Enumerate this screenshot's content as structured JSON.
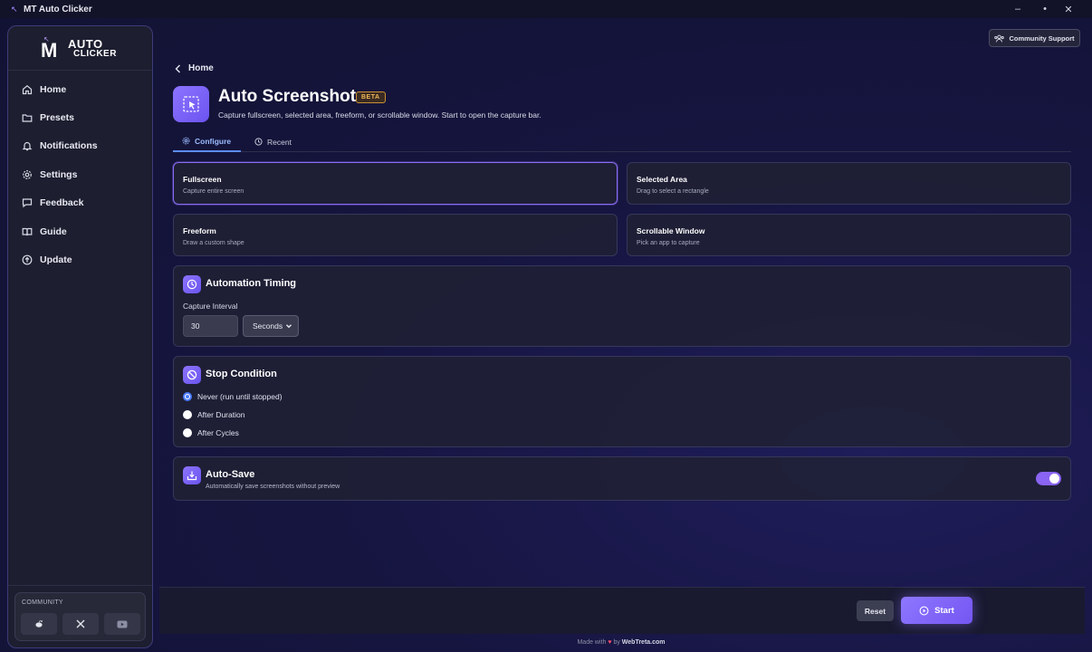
{
  "window": {
    "title": "MT Auto Clicker",
    "minimize": "–",
    "maximize": "•",
    "close": "✕"
  },
  "logo": {
    "mark": "M",
    "line1": "AUTO",
    "line2": "CLICKER"
  },
  "sidebar": {
    "items": [
      {
        "label": "Home",
        "icon": "home-icon"
      },
      {
        "label": "Presets",
        "icon": "folder-icon"
      },
      {
        "label": "Notifications",
        "icon": "bell-icon"
      },
      {
        "label": "Settings",
        "icon": "gear-icon"
      },
      {
        "label": "Feedback",
        "icon": "message-icon"
      },
      {
        "label": "Guide",
        "icon": "book-icon"
      },
      {
        "label": "Update",
        "icon": "upload-circle-icon"
      }
    ],
    "community": {
      "label": "COMMUNITY",
      "links": [
        "reddit-icon",
        "x-icon",
        "youtube-icon"
      ]
    }
  },
  "header": {
    "support_button": "Community Support",
    "breadcrumb": "Home",
    "title": "Auto Screenshot",
    "badge": "BETA",
    "subtitle": "Capture fullscreen, selected area, freeform, or scrollable window. Start to open the capture bar."
  },
  "tabs": [
    {
      "label": "Configure",
      "active": true
    },
    {
      "label": "Recent",
      "active": false
    }
  ],
  "modes": [
    {
      "title": "Fullscreen",
      "desc": "Capture entire screen",
      "selected": true
    },
    {
      "title": "Selected Area",
      "desc": "Drag to select a rectangle",
      "selected": false
    },
    {
      "title": "Freeform",
      "desc": "Draw a custom shape",
      "selected": false
    },
    {
      "title": "Scrollable Window",
      "desc": "Pick an app to capture",
      "selected": false
    }
  ],
  "timing": {
    "title": "Automation Timing",
    "interval_label": "Capture Interval",
    "interval_value": "30",
    "unit": "Seconds"
  },
  "stop": {
    "title": "Stop Condition",
    "options": [
      {
        "label": "Never (run until stopped)",
        "checked": true
      },
      {
        "label": "After Duration",
        "checked": false
      },
      {
        "label": "After Cycles",
        "checked": false
      }
    ]
  },
  "autosave": {
    "title": "Auto-Save",
    "desc": "Automatically save screenshots without preview",
    "enabled": true
  },
  "actions": {
    "reset": "Reset",
    "start": "Start"
  },
  "footer": {
    "made_with": "Made with",
    "by": "by",
    "brand": "WebTreta.com"
  },
  "colors": {
    "accent": "#7d62f5",
    "tab_active": "#9dbdff",
    "badge": "#f0b857"
  }
}
